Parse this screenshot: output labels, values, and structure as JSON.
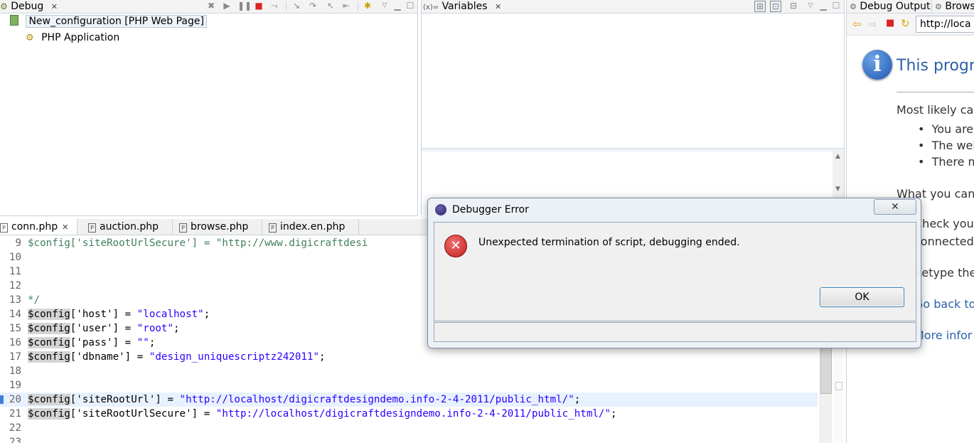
{
  "debug_view": {
    "tab_label": "Debug",
    "tree": [
      {
        "label": "New_configuration [PHP Web Page]"
      },
      {
        "label": "PHP Application"
      }
    ]
  },
  "variables_view": {
    "tab_label": "Variables"
  },
  "right_view": {
    "tabs": [
      "Debug Output",
      "Browse"
    ],
    "address": "http://loca",
    "page_title": "This progra",
    "lines": [
      "Most likely cau",
      "You are",
      "The web",
      "There m",
      "What you can",
      "Check you",
      "connected",
      "Retype the",
      "Go back to",
      "More infor"
    ]
  },
  "editor": {
    "tabs": [
      {
        "label": "conn.php",
        "active": true
      },
      {
        "label": "auction.php"
      },
      {
        "label": "browse.php"
      },
      {
        "label": "index.en.php"
      }
    ],
    "lines": [
      {
        "n": "9",
        "var": "$config",
        "rest": "['siteRootUrlSecure'] = \"http://www.digicraftdesi",
        "kind": "comment"
      },
      {
        "n": "10",
        "var": "",
        "rest": "",
        "kind": "comment"
      },
      {
        "n": "11",
        "var": "",
        "rest": "",
        "kind": "comment"
      },
      {
        "n": "12",
        "var": "",
        "rest": "",
        "kind": "comment"
      },
      {
        "n": "13",
        "var": "",
        "rest": "*/",
        "kind": "comment"
      },
      {
        "n": "14",
        "var": "$config",
        "key": "['host'] = ",
        "val": "\"localhost\"",
        "end": ";"
      },
      {
        "n": "15",
        "var": "$config",
        "key": "['user'] = ",
        "val": "\"root\"",
        "end": ";"
      },
      {
        "n": "16",
        "var": "$config",
        "key": "['pass'] = ",
        "val": "\"\"",
        "end": ";"
      },
      {
        "n": "17",
        "var": "$config",
        "key": "['dbname'] = ",
        "val": "\"design_uniquescriptz242011\"",
        "end": ";"
      },
      {
        "n": "18",
        "var": "",
        "rest": ""
      },
      {
        "n": "19",
        "var": "",
        "rest": ""
      },
      {
        "n": "20",
        "var": "$config",
        "key": "['siteRootUrl'] = ",
        "val": "\"http://localhost/digicraftdesigndemo.info-2-4-2011/public_html/\"",
        "end": ";",
        "highlight": true
      },
      {
        "n": "21",
        "var": "$config",
        "key": "['siteRootUrlSecure'] = ",
        "val": "\"http://localhost/digicraftdesigndemo.info-2-4-2011/public_html/\"",
        "end": ";"
      },
      {
        "n": "22",
        "var": "",
        "rest": ""
      },
      {
        "n": "23",
        "var": "",
        "rest": ""
      }
    ]
  },
  "dialog": {
    "title": "Debugger Error",
    "message": "Unexpected termination of script, debugging ended.",
    "ok_label": "OK",
    "close_glyph": "✕"
  },
  "colors": {
    "link_blue": "#2b5fa8",
    "error_red": "#cc1f1f",
    "highlight_line": "#e8f2fe"
  }
}
